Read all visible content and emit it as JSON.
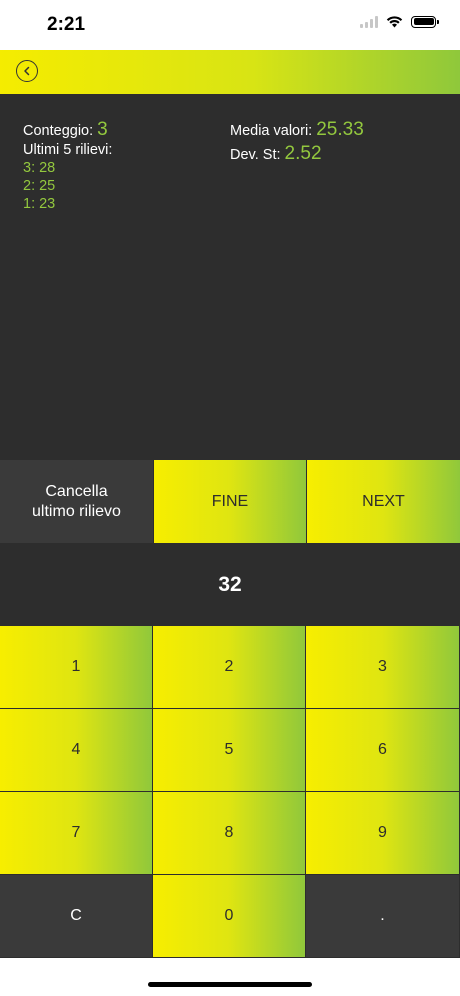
{
  "status": {
    "time": "2:21"
  },
  "stats": {
    "count_label": "Conteggio:",
    "count_value": "3",
    "last_label": "Ultimi 5 rilievi:",
    "last_items": [
      "3: 28",
      "2: 25",
      "1: 23"
    ],
    "mean_label": "Media valori:",
    "mean_value": "25.33",
    "std_label": "Dev. St:",
    "std_value": "2.52"
  },
  "actions": {
    "delete_line1": "Cancella",
    "delete_line2": "ultimo rilievo",
    "fine": "FINE",
    "next": "NEXT"
  },
  "display": {
    "value": "32"
  },
  "keypad": {
    "keys": [
      "1",
      "2",
      "3",
      "4",
      "5",
      "6",
      "7",
      "8",
      "9",
      "C",
      "0",
      "."
    ]
  },
  "colors": {
    "accent_green": "#93c83e",
    "dark_bg": "#2d2d2d",
    "key_yellow": "#f7ee00"
  }
}
